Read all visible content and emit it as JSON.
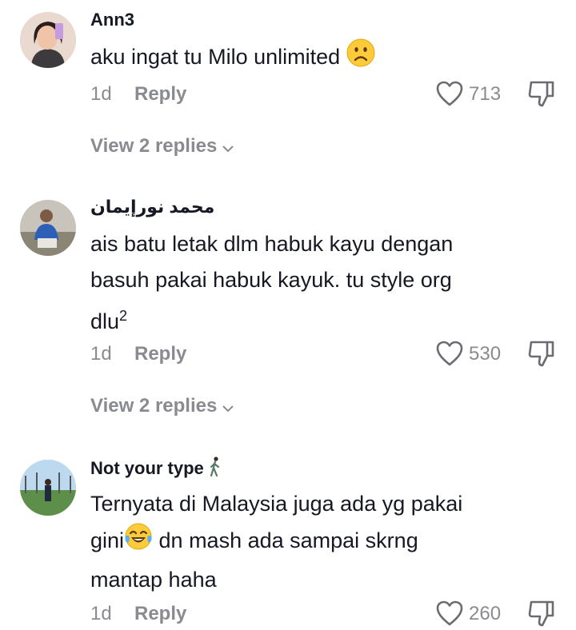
{
  "comments": [
    {
      "username": "Ann3",
      "text": "aku ingat tu Milo unlimited",
      "emoji": "slightly-frowning-face",
      "time": "1d",
      "reply_label": "Reply",
      "likes": "713",
      "view_replies": "View 2 replies"
    },
    {
      "username": "محمد نورإيمان",
      "text_lines": [
        "ais batu letak dlm habuk kayu dengan",
        "basuh pakai habuk kayuk. tu style org",
        "dlu"
      ],
      "superscript": "2",
      "time": "1d",
      "reply_label": "Reply",
      "likes": "530",
      "view_replies": "View 2 replies"
    },
    {
      "username": "Not your type",
      "username_emoji": "person-walking",
      "text_line1": "Ternyata di Malaysia juga ada yg pakai",
      "text_line2a": "gini",
      "emoji": "tears-of-joy",
      "text_line2b": " dn mash ada sampai skrng",
      "text_line3": "mantap haha",
      "time": "1d",
      "reply_label": "Reply",
      "likes": "260"
    }
  ],
  "colors": {
    "primary_text": "#161823",
    "secondary_text": "#8a8b91",
    "background": "#ffffff"
  }
}
